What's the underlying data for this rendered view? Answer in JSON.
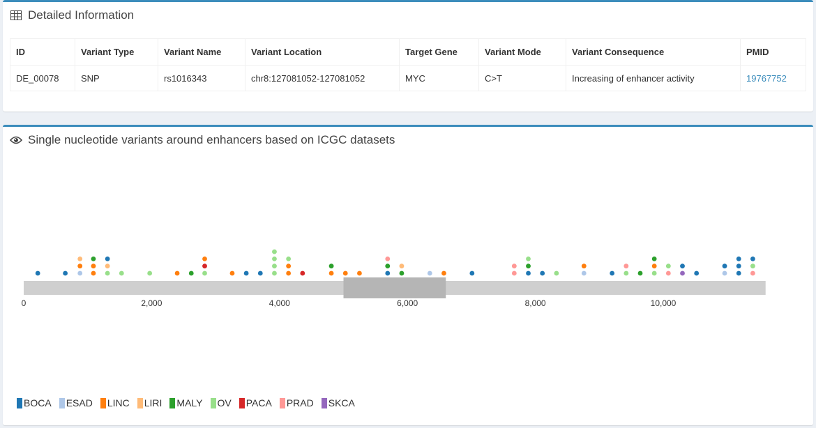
{
  "details": {
    "title": "Detailed Information",
    "columns": [
      "ID",
      "Variant Type",
      "Variant Name",
      "Variant Location",
      "Target Gene",
      "Variant Mode",
      "Variant Consequence",
      "PMID"
    ],
    "row": [
      "DE_00078",
      "SNP",
      "rs1016343",
      "chr8:127081052-127081052",
      "MYC",
      "C>T",
      "Increasing of enhancer activity",
      "19767752"
    ]
  },
  "variants": {
    "title": "Single nucleotide variants around enhancers based on ICGC datasets"
  },
  "chart_data": {
    "type": "scatter",
    "title": "",
    "xlabel": "",
    "ylabel": "",
    "xlim": [
      0,
      11600
    ],
    "xticks": [
      0,
      2000,
      4000,
      6000,
      8000,
      10000
    ],
    "xtick_labels": [
      "0",
      "2,000",
      "4,000",
      "6,000",
      "8,000",
      "10,000"
    ],
    "enhancer_region": [
      5000,
      6600
    ],
    "legend_position": "bottom-left",
    "categories": [
      "BOCA",
      "ESAD",
      "LINC",
      "LIRI",
      "MALY",
      "OV",
      "PACA",
      "PRAD",
      "SKCA"
    ],
    "colors": {
      "BOCA": "#1f77b4",
      "ESAD": "#aec7e8",
      "LINC": "#ff7f0e",
      "LIRI": "#ffbb78",
      "MALY": "#2ca02c",
      "OV": "#98df8a",
      "PACA": "#d62728",
      "PRAD": "#ff9896",
      "SKCA": "#9467bd"
    },
    "points": [
      {
        "pos": 220,
        "stack": [
          "BOCA"
        ]
      },
      {
        "pos": 650,
        "stack": [
          "BOCA"
        ]
      },
      {
        "pos": 880,
        "stack": [
          "ESAD",
          "LINC",
          "LIRI"
        ]
      },
      {
        "pos": 1090,
        "stack": [
          "LINC",
          "LINC",
          "MALY"
        ]
      },
      {
        "pos": 1310,
        "stack": [
          "OV",
          "LIRI",
          "BOCA"
        ]
      },
      {
        "pos": 1530,
        "stack": [
          "OV"
        ]
      },
      {
        "pos": 1970,
        "stack": [
          "OV"
        ]
      },
      {
        "pos": 2400,
        "stack": [
          "LINC"
        ]
      },
      {
        "pos": 2620,
        "stack": [
          "MALY"
        ]
      },
      {
        "pos": 2830,
        "stack": [
          "OV",
          "PACA",
          "LINC"
        ]
      },
      {
        "pos": 3260,
        "stack": [
          "LINC"
        ]
      },
      {
        "pos": 3480,
        "stack": [
          "BOCA"
        ]
      },
      {
        "pos": 3700,
        "stack": [
          "BOCA"
        ]
      },
      {
        "pos": 3920,
        "stack": [
          "OV",
          "OV",
          "OV",
          "OV"
        ]
      },
      {
        "pos": 4140,
        "stack": [
          "LINC",
          "LINC",
          "OV"
        ]
      },
      {
        "pos": 4360,
        "stack": [
          "PACA"
        ]
      },
      {
        "pos": 4810,
        "stack": [
          "LINC",
          "MALY"
        ]
      },
      {
        "pos": 5030,
        "stack": [
          "LINC"
        ]
      },
      {
        "pos": 5250,
        "stack": [
          "LINC"
        ]
      },
      {
        "pos": 5690,
        "stack": [
          "BOCA",
          "MALY",
          "PRAD"
        ]
      },
      {
        "pos": 5910,
        "stack": [
          "MALY",
          "LIRI"
        ]
      },
      {
        "pos": 6350,
        "stack": [
          "ESAD"
        ]
      },
      {
        "pos": 6570,
        "stack": [
          "LINC"
        ]
      },
      {
        "pos": 7010,
        "stack": [
          "BOCA"
        ]
      },
      {
        "pos": 7670,
        "stack": [
          "PRAD",
          "PRAD"
        ]
      },
      {
        "pos": 7890,
        "stack": [
          "BOCA",
          "MALY",
          "OV"
        ]
      },
      {
        "pos": 8110,
        "stack": [
          "BOCA"
        ]
      },
      {
        "pos": 8330,
        "stack": [
          "OV"
        ]
      },
      {
        "pos": 8760,
        "stack": [
          "ESAD",
          "LINC"
        ]
      },
      {
        "pos": 9200,
        "stack": [
          "BOCA"
        ]
      },
      {
        "pos": 9420,
        "stack": [
          "OV",
          "PRAD"
        ]
      },
      {
        "pos": 9640,
        "stack": [
          "MALY"
        ]
      },
      {
        "pos": 9860,
        "stack": [
          "OV",
          "LINC",
          "MALY"
        ]
      },
      {
        "pos": 10080,
        "stack": [
          "PRAD",
          "OV"
        ]
      },
      {
        "pos": 10300,
        "stack": [
          "SKCA",
          "BOCA"
        ]
      },
      {
        "pos": 10520,
        "stack": [
          "BOCA"
        ]
      },
      {
        "pos": 10960,
        "stack": [
          "ESAD",
          "BOCA"
        ]
      },
      {
        "pos": 11180,
        "stack": [
          "BOCA",
          "BOCA",
          "BOCA"
        ]
      },
      {
        "pos": 11400,
        "stack": [
          "PRAD",
          "OV",
          "BOCA"
        ]
      }
    ]
  }
}
